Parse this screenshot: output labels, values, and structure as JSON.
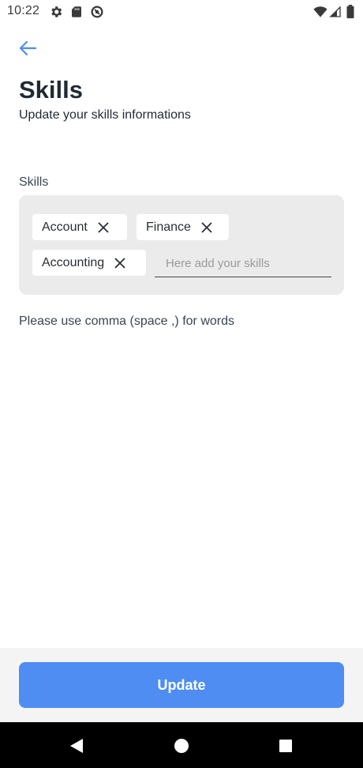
{
  "status_bar": {
    "time": "10:22",
    "left_icons": [
      "gear-icon",
      "sd-card-icon",
      "vpn-icon"
    ],
    "right_icons": [
      "wifi-icon",
      "signal-icon",
      "battery-icon"
    ]
  },
  "header": {
    "back_icon": "arrow-left-icon",
    "title": "Skills",
    "subtitle": "Update your skills informations"
  },
  "skills": {
    "label": "Skills",
    "chips": [
      {
        "label": "Account"
      },
      {
        "label": "Finance"
      },
      {
        "label": "Accounting"
      }
    ],
    "input_placeholder": "Here add your skills",
    "input_value": "",
    "helper": "Please use comma (space ,) for words"
  },
  "actions": {
    "update_label": "Update"
  },
  "navigation_bar": {
    "buttons": [
      "back-triangle-icon",
      "home-circle-icon",
      "recents-square-icon"
    ]
  },
  "colors": {
    "accent": "#4f8df3",
    "box_background": "#ebebeb",
    "text_dark": "#1f2a33"
  }
}
